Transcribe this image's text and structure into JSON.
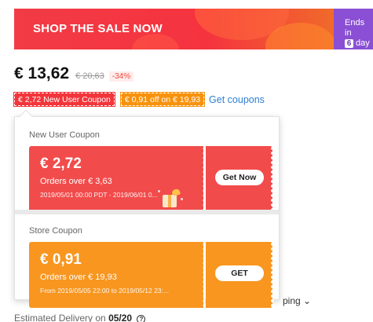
{
  "banner": {
    "title": "SHOP THE SALE NOW",
    "side_line1": "Ends in",
    "side_days_num": "6",
    "side_days_label": "day"
  },
  "price": {
    "current": "€ 13,62",
    "original": "€ 20,63",
    "discount": "-34%"
  },
  "tags": {
    "new_user": "€ 2,72 New User Coupon",
    "store": "€ 0,91 off on € 19,93",
    "get_coupons": "Get coupons"
  },
  "popup": {
    "new_user_section": "New User Coupon",
    "store_section": "Store Coupon",
    "new_user_coupon": {
      "amount": "€ 2,72",
      "condition": "Orders over € 3,63",
      "dates": "2019/05/01 00:00 PDT - 2019/06/01 0...",
      "button": "Get Now"
    },
    "store_coupon": {
      "amount": "€ 0,91",
      "condition": "Orders over € 19,93",
      "dates": "From 2019/05/05 22:00 to 2019/05/12 23:...",
      "button": "GET"
    }
  },
  "background": {
    "shipping": "ping",
    "delivery_label": "Estimated Delivery on",
    "delivery_date": "05/20"
  },
  "colors": {
    "banner_red": "#f23b45",
    "banner_purple": "#8a4fd4",
    "coupon_red": "#f24b4b",
    "coupon_orange": "#f89620",
    "link_blue": "#2f7fd3"
  }
}
